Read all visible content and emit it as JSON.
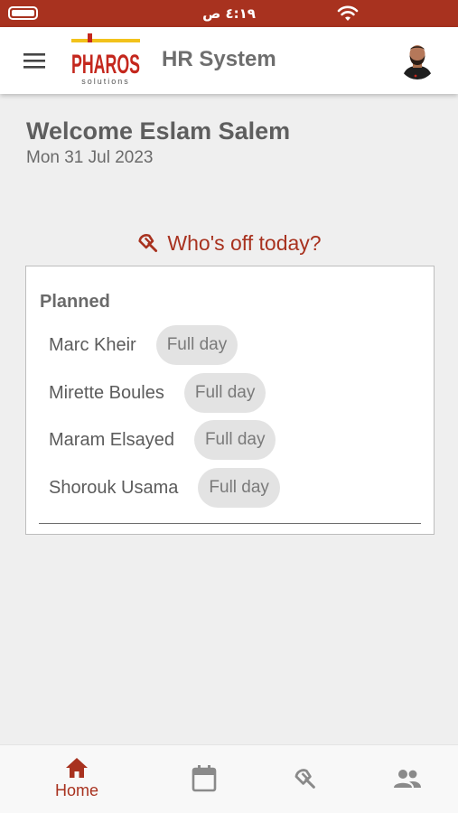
{
  "status_bar": {
    "time": "٤:١٩ ص",
    "battery_level": 1.0,
    "battery_icon": "battery-icon",
    "wifi_icon": "wifi-icon"
  },
  "app_bar": {
    "title": "HR System",
    "menu_icon": "menu-icon",
    "logo_text": "PHAROS",
    "logo_subtext": "solutions",
    "avatar": "user-avatar"
  },
  "welcome": {
    "greeting": "Welcome Eslam Salem",
    "date": "Mon 31 Jul 2023"
  },
  "whos_off": {
    "heading": "Who's off today?",
    "icon": "umbrella-icon",
    "section_title": "Planned",
    "entries": [
      {
        "name": "Marc Kheir",
        "duration": "Full day"
      },
      {
        "name": "Mirette Boules",
        "duration": "Full day"
      },
      {
        "name": "Maram Elsayed",
        "duration": "Full day"
      },
      {
        "name": "Shorouk Usama",
        "duration": "Full day"
      }
    ]
  },
  "bottom_nav": {
    "items": [
      {
        "label": "Home",
        "icon": "home-icon",
        "active": true
      },
      {
        "label": "",
        "icon": "calendar-icon",
        "active": false
      },
      {
        "label": "",
        "icon": "umbrella-icon",
        "active": false
      },
      {
        "label": "",
        "icon": "people-icon",
        "active": false
      }
    ]
  },
  "colors": {
    "brand": "#a8321f",
    "background": "#efefef",
    "chip": "#e3e3e3",
    "inactive_icon": "#8a8a8a"
  }
}
